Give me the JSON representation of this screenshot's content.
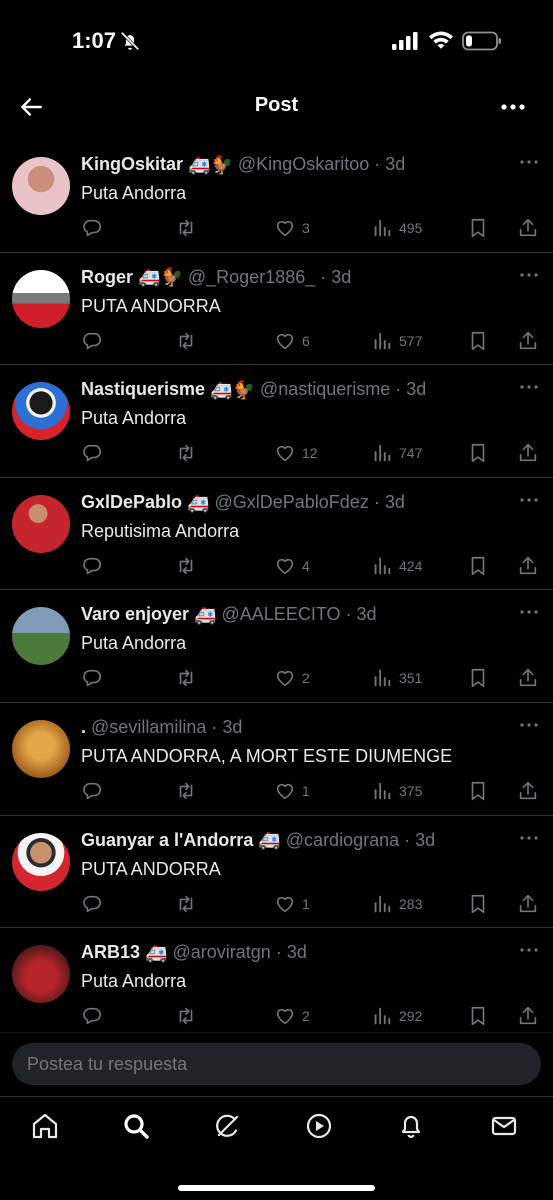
{
  "status_bar": {
    "time": "1:07"
  },
  "header": {
    "title": "Post"
  },
  "replies": [
    {
      "name": "KingOskitar",
      "emojis": "🚑🐓",
      "handle": "@KingOskaritoo",
      "sep": "·",
      "age": "3d",
      "text": "Puta Andorra",
      "likes": "3",
      "views": "495"
    },
    {
      "name": "Roger",
      "emojis": "🚑🐓",
      "handle": "@_Roger1886_",
      "sep": "·",
      "age": "3d",
      "text": "PUTA ANDORRA",
      "likes": "6",
      "views": "577"
    },
    {
      "name": "Nastiquerisme",
      "emojis": "🚑🐓",
      "handle": "@nastiquerisme",
      "sep": "·",
      "age": "3d",
      "text": "Puta Andorra",
      "likes": "12",
      "views": "747"
    },
    {
      "name": "GxlDePablo",
      "emojis": "🚑",
      "handle": "@GxlDePabloFdez",
      "sep": "·",
      "age": "3d",
      "text": "Reputisima Andorra",
      "likes": "4",
      "views": "424"
    },
    {
      "name": "Varo enjoyer",
      "emojis": "🚑",
      "handle": "@AALEECITO",
      "sep": "·",
      "age": "3d",
      "text": "Puta Andorra",
      "likes": "2",
      "views": "351"
    },
    {
      "name": ".",
      "emojis": "",
      "handle": "@sevillamilina",
      "sep": "·",
      "age": "3d",
      "text": "PUTA ANDORRA, A MORT ESTE DIUMENGE",
      "likes": "1",
      "views": "375"
    },
    {
      "name": "Guanyar a l'Andorra",
      "emojis": "🚑",
      "handle": "@cardiograna",
      "sep": "·",
      "age": "3d",
      "text": "PUTA ANDORRA",
      "likes": "1",
      "views": "283"
    },
    {
      "name": "ARB13",
      "emojis": "🚑",
      "handle": "@aroviratgn",
      "sep": "·",
      "age": "3d",
      "text": "Puta Andorra",
      "likes": "2",
      "views": "292"
    }
  ],
  "composer": {
    "placeholder": "Postea tu respuesta"
  },
  "nav": [
    "home-icon",
    "search-icon",
    "grok-icon",
    "video-icon",
    "notifications-icon",
    "messages-icon"
  ],
  "colors": {
    "background": "#000000",
    "text": "#e7e9ea",
    "muted": "#71767b",
    "divider": "#2f3336",
    "composer": "#202327"
  }
}
